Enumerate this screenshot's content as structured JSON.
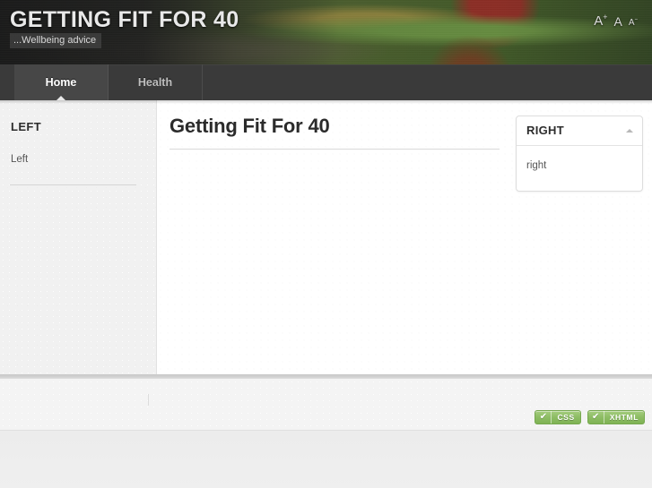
{
  "header": {
    "site_title": "GETTING FIT FOR 40",
    "tagline": "...Wellbeing advice",
    "font_size_controls": [
      {
        "name": "increase",
        "letter": "A",
        "sign": "+"
      },
      {
        "name": "reset",
        "letter": "A",
        "sign": ""
      },
      {
        "name": "decrease",
        "letter": "A",
        "sign": "−"
      }
    ]
  },
  "nav": {
    "items": [
      {
        "label": "Home",
        "active": true
      },
      {
        "label": "Health",
        "active": false
      }
    ]
  },
  "left_sidebar": {
    "title": "LEFT",
    "text": "Left"
  },
  "main": {
    "page_title": "Getting Fit For 40"
  },
  "right_sidebar": {
    "panel_title": "RIGHT",
    "panel_text": "right",
    "toggle_icon": "chevron-up-icon"
  },
  "footer": {
    "separator": "|",
    "badges": [
      {
        "check": "✔",
        "label": "CSS"
      },
      {
        "check": "✔",
        "label": "XHTML"
      }
    ]
  },
  "colors": {
    "header_bg": "#2f2f2f",
    "nav_bg": "#3a3a3a",
    "nav_active_bg": "#474747",
    "content_bg": "#ffffff",
    "sidebar_bg": "#f1f1f1",
    "badge_green": "#8dbd64",
    "text_dark": "#2d2d2d"
  }
}
